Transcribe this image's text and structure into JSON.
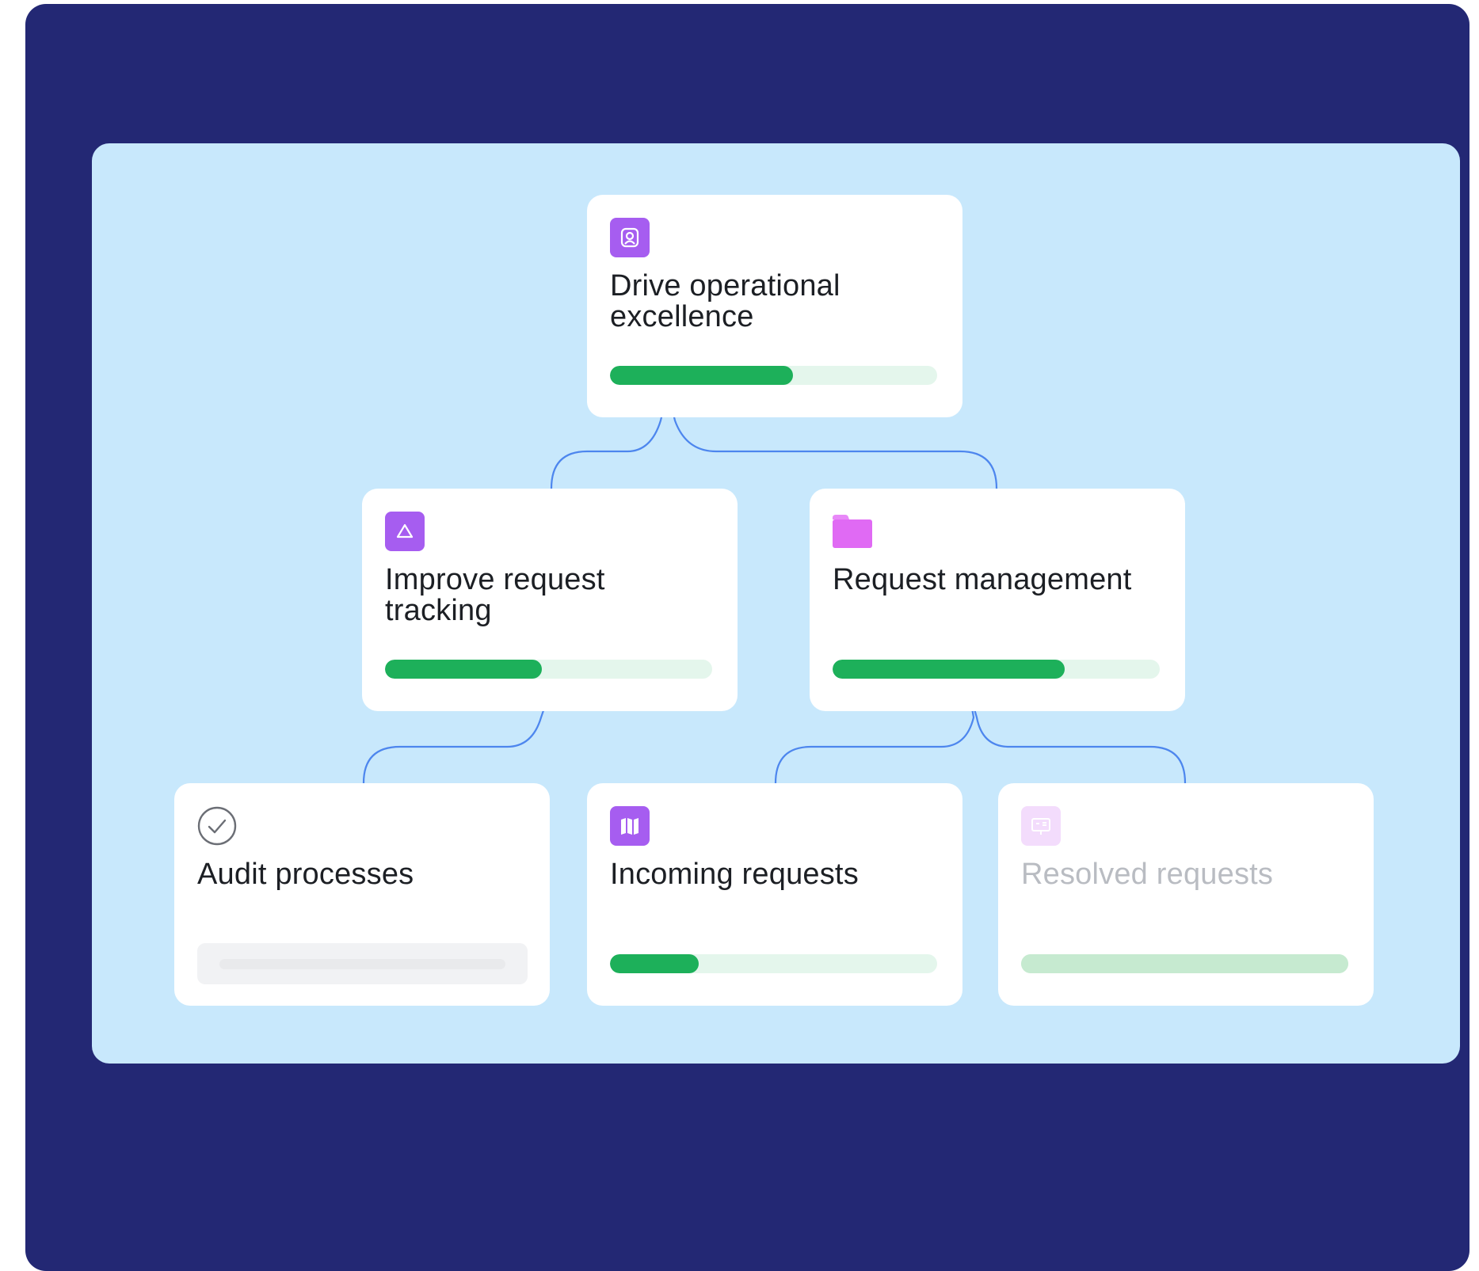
{
  "colors": {
    "frame": "#232874",
    "board": "#c8e8fc",
    "connector": "#4d86ee",
    "progress": "#1db05a",
    "progress_track": "#e4f6ec",
    "purple_icon": "#a65df0",
    "pink_icon": "#e06af4"
  },
  "goals": {
    "top": {
      "title": "Drive operational excellence",
      "icon": "person-badge-icon",
      "progress": 0.56
    },
    "improve": {
      "title": "Improve request tracking",
      "icon": "triangle-icon",
      "progress": 0.48
    },
    "management": {
      "title": "Request management",
      "icon": "folder-icon",
      "progress": 0.71
    },
    "audit": {
      "title": "Audit processes",
      "icon": "check-circle-icon",
      "progress": 0
    },
    "incoming": {
      "title": "Incoming requests",
      "icon": "map-icon",
      "progress": 0.27
    },
    "resolved": {
      "title": "Resolved requests",
      "icon": "presentation-icon",
      "progress": 1.0
    }
  }
}
